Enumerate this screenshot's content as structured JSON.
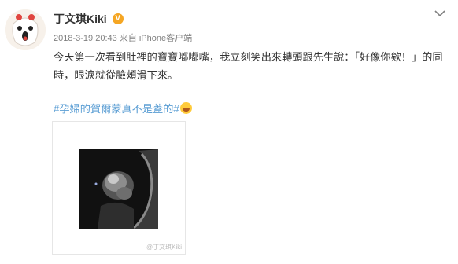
{
  "post": {
    "username": "丁文琪Kiki",
    "verified_badge": "V",
    "timestamp": "2018-3-19 20:43",
    "source_prefix": "来自",
    "source": "iPhone客户端",
    "text": "今天第一次看到肚裡的寶寶嘟嘟嘴，我立刻笑出來轉頭跟先生說：「好像你欸！」的同時，眼淚就從臉頰滑下來。",
    "hashtag": "#孕婦的賀爾蒙真不是蓋的#",
    "watermark": "@丁文琪Kiki",
    "menu_icon": "chevron-down-icon",
    "avatar_icon": "cartoon-avatar",
    "emoji_icon": "laugh-cry-emoji",
    "colors": {
      "hashtag": "#5b9ed4",
      "verified": "#f5a623",
      "meta": "#808080",
      "text": "#333333"
    }
  }
}
